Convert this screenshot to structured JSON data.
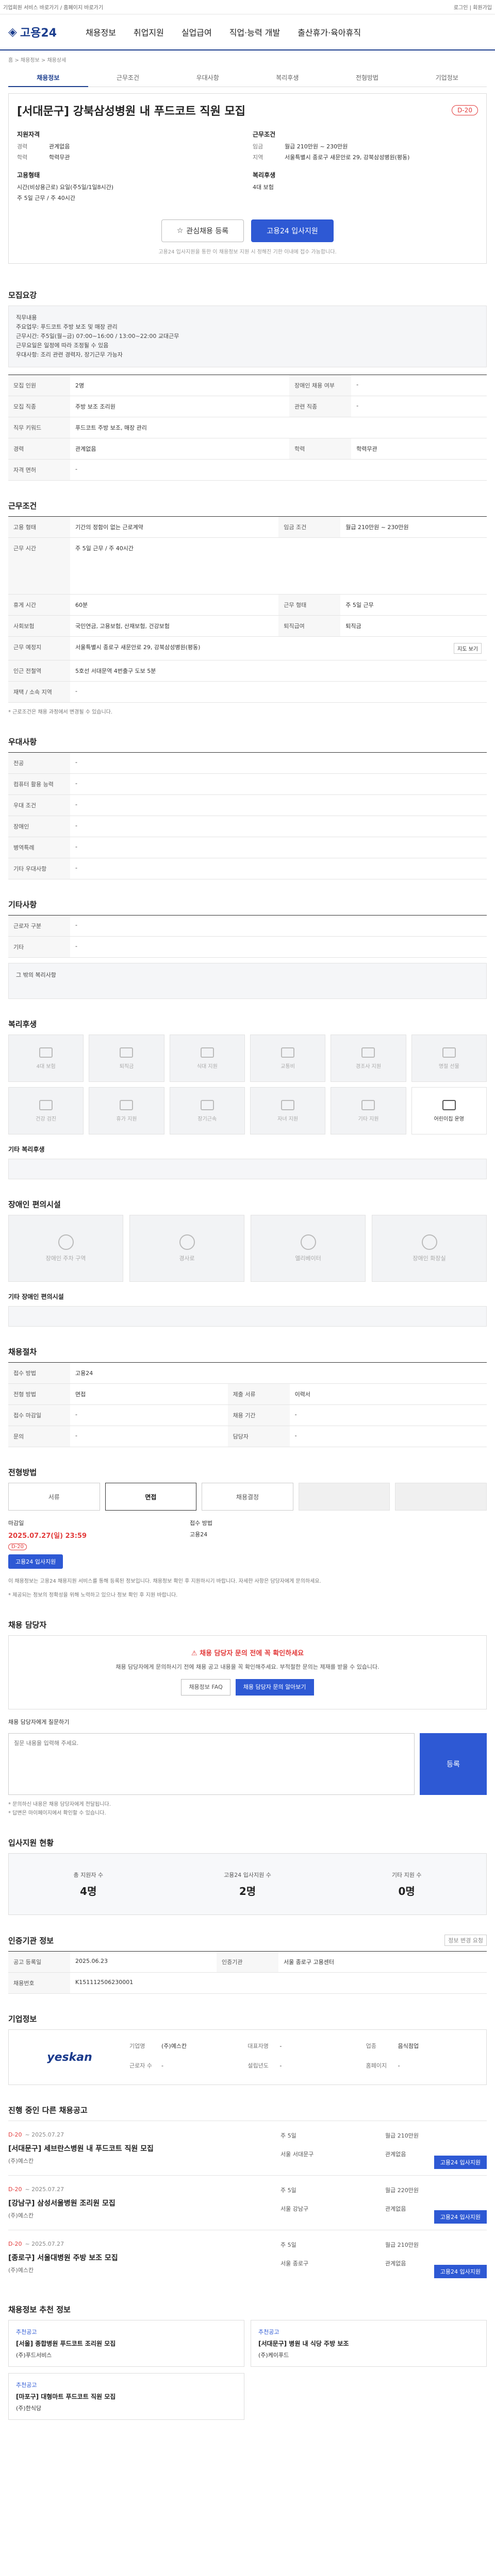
{
  "topbar": {
    "left": "기업회원 서비스 바로가기 / 홈페이지 바로가기",
    "right": "로그인 | 회원가입"
  },
  "logo": "고용24",
  "nav": [
    "채용정보",
    "취업지원",
    "실업급여",
    "직업·능력 개발",
    "출산휴가·육아휴직"
  ],
  "breadcrumb": "홈 > 채용정보 > 채용상세",
  "tabs": [
    "채용정보",
    "근무조건",
    "우대사항",
    "복리후생",
    "전형방법",
    "기업정보"
  ],
  "header": {
    "title": "[서대문구] 강북삼성병원 내 푸드코트 직원 모집",
    "badge": "D-20",
    "left_title": "지원자격",
    "left_rows": [
      {
        "k": "경력",
        "v": "관계없음"
      },
      {
        "k": "학력",
        "v": "학력무관"
      }
    ],
    "left_title2": "고용형태",
    "left_rows2": [
      {
        "k": "",
        "v": "시간(비상용근로) 요일(주5일/1일8시간)"
      },
      {
        "k": "",
        "v": "주 5일 근무 / 주 40시간"
      }
    ],
    "right_title": "근무조건",
    "right_rows": [
      {
        "k": "임금",
        "v": "월급 210만원 ~ 230만원"
      },
      {
        "k": "지역",
        "v": "서울특별시 종로구 새문안로 29, 강북삼성병원(평동)"
      },
      {
        "k": "",
        "v": ""
      }
    ],
    "right_title2": "복리후생",
    "right_rows2": [
      {
        "k": "",
        "v": "4대 보험"
      }
    ],
    "btn_scrap": "관심채용 등록",
    "btn_apply": "고용24 입사지원",
    "notice": "고용24 입사지원을 통한 이 채용정보 지원 시 정해진 기한 이내에 접수 가능합니다."
  },
  "recruit": {
    "title": "모집요강",
    "desc": "직무내용\n주요업무: 푸드코트 주방 보조 및 매장 관리\n근무시간: 주5일(월~금) 07:00~16:00 / 13:00~22:00 교대근무\n근무요일은 일정에 따라 조정될 수 있음\n우대사항: 조리 관련 경력자, 장기근무 가능자",
    "rows": [
      {
        "k": "모집 인원",
        "v": "2명",
        "k2": "장애인 채용 여부",
        "v2": "-"
      },
      {
        "k": "모집 직종",
        "v": "주방 보조 조리원",
        "k2": "관련 직종",
        "v2": "-"
      },
      {
        "k": "직무 키워드",
        "v": "푸드코트 주방 보조, 매장 관리",
        "k2": "",
        "v2": ""
      },
      {
        "k": "경력",
        "v": "관계없음",
        "k2": "학력",
        "v2": "학력무관"
      },
      {
        "k": "자격 면허",
        "v": "-",
        "k2": "",
        "v2": ""
      }
    ]
  },
  "condition": {
    "title": "근무조건",
    "rows": [
      {
        "k": "고용 형태",
        "v": "기간의 정함이 없는 근로계약",
        "k2": "임금 조건",
        "v2": "월급 210만원 ~ 230만원"
      },
      {
        "k": "근무 시간",
        "v": "주 5일 근무 / 주 40시간",
        "k2": "",
        "v2": ""
      },
      {
        "k": "휴게 시간",
        "v": "60분",
        "k2": "근무 형태",
        "v2": "주 5일 근무"
      },
      {
        "k": "사회보험",
        "v": "국민연금, 고용보험, 산재보험, 건강보험",
        "k2": "퇴직급여",
        "v2": "퇴직금"
      },
      {
        "k": "근무 예정지",
        "v": "서울특별시 종로구 새문안로 29, 강북삼성병원(평동)",
        "k2": "",
        "v2": ""
      },
      {
        "k": "인근 전철역",
        "v": "5호선 서대문역 4번출구 도보 5분",
        "k2": "",
        "v2": ""
      },
      {
        "k": "재택 / 소속 지역",
        "v": "-",
        "k2": "",
        "v2": ""
      }
    ],
    "map_btn": "지도 보기",
    "footnote": "* 근로조건은 채용 과정에서 변경될 수 있습니다."
  },
  "prefer": {
    "title": "우대사항",
    "rows": [
      {
        "k": "전공",
        "v": "-"
      },
      {
        "k": "컴퓨터 활용 능력",
        "v": "-"
      },
      {
        "k": "우대 조건",
        "v": "-"
      },
      {
        "k": "장애인",
        "v": "-"
      },
      {
        "k": "병역특례",
        "v": "-"
      },
      {
        "k": "기타 우대사항",
        "v": "-"
      }
    ]
  },
  "etc": {
    "title": "기타사항",
    "rows": [
      {
        "k": "근로자 구분",
        "v": "-"
      },
      {
        "k": "기타",
        "v": "-"
      }
    ],
    "extra": "그 밖의 복리사항"
  },
  "welfare": {
    "title": "복리후생",
    "items": [
      "4대 보험",
      "퇴직금",
      "식대 지원",
      "교통비",
      "경조사 지원",
      "명절 선물",
      "건강 검진",
      "휴가 지원",
      "장기근속",
      "자녀 지원",
      "기타 지원",
      "어린이집 운영"
    ],
    "extra_title": "기타 복리후생"
  },
  "disabled": {
    "title": "장애인 편의시설",
    "items": [
      "장애인 주차 구역",
      "경사로",
      "엘리베이터",
      "장애인 화장실"
    ],
    "extra_title": "기타 장애인 편의시설"
  },
  "hiring": {
    "title": "채용절차",
    "rows": [
      {
        "k": "접수 방법",
        "v": "고용24",
        "k2": "",
        "v2": ""
      },
      {
        "k": "전형 방법",
        "v": "면접",
        "k2": "제출 서류",
        "v2": "이력서"
      },
      {
        "k": "접수 마감일",
        "v": "-",
        "k2": "채용 기간",
        "v2": "-"
      },
      {
        "k": "문의",
        "v": "-",
        "k2": "담당자",
        "v2": "-"
      }
    ]
  },
  "process": {
    "title": "전형방법",
    "steps": [
      "서류",
      "면접",
      "채용결정",
      "",
      ""
    ],
    "deadline_label": "마감일",
    "deadline": "2025.07.27(일) 23:59",
    "dday": "D-20",
    "apply_btn": "고용24 입사지원",
    "method_label": "접수 방법",
    "method": "고용24"
  },
  "notice": {
    "text": "이 채용정보는 고용24 채용지원 서비스를 통해 등록된 정보입니다. 채용정보 확인 후 지원하시기 바랍니다. 자세한 사항은 담당자에게 문의하세요.",
    "footnote": "* 제공되는 정보의 정확성을 위해 노력하고 있으나 정보 확인 후 지원 바랍니다."
  },
  "inquiry": {
    "title": "채용 담당자",
    "warn_head": "채용 담당자 문의 전에 꼭 확인하세요",
    "warn_text": "채용 담당자에게 문의하시기 전에 채용 공고 내용을 꼭 확인해주세요. 부적절한 문의는 제재를 받을 수 있습니다.",
    "btn1": "채용정보 FAQ",
    "btn2": "채용 담당자 문의 알아보기",
    "form_title": "채용 담당자에게 질문하기",
    "placeholder": "질문 내용을 입력해 주세요.",
    "send": "등록",
    "notes": "* 문의하신 내용은 채용 담당자에게 전달됩니다.\n* 답변은 마이페이지에서 확인할 수 있습니다."
  },
  "stats": {
    "title": "입사지원 현황",
    "items": [
      {
        "label": "총 지원자 수",
        "num": "4명"
      },
      {
        "label": "고용24 입사지원 수",
        "num": "2명"
      },
      {
        "label": "기타 지원 수",
        "num": "0명"
      }
    ]
  },
  "regist": {
    "title": "인증기관 정보",
    "rows": [
      {
        "k": "공고 등록일",
        "v": "2025.06.23",
        "k2": "인증기관",
        "v2": "서울 종로구 고용센터"
      },
      {
        "k": "채용번호",
        "v": "K151112506230001",
        "k2": "",
        "v2": ""
      }
    ],
    "btn": "정보 변경 요청"
  },
  "company": {
    "title": "기업정보",
    "logo": "yeskan",
    "rows": [
      {
        "k": "기업명",
        "v": "(주)예스칸"
      },
      {
        "k": "대표자명",
        "v": "-"
      },
      {
        "k": "업종",
        "v": "음식점업"
      },
      {
        "k": "근로자 수",
        "v": "-"
      },
      {
        "k": "설립년도",
        "v": "-"
      },
      {
        "k": "홈페이지",
        "v": "-"
      }
    ]
  },
  "jobs": {
    "title": "진행 중인 다른 채용공고",
    "items": [
      {
        "date": "D-20",
        "range": "~ 2025.07.27",
        "title": "[서대문구] 세브란스병원 내 푸드코트 직원 모집",
        "company": "(주)예스칸",
        "info": [
          "주 5일",
          "월급 210만원",
          "서울 서대문구",
          "관계없음"
        ],
        "btn": "고용24 입사지원"
      },
      {
        "date": "D-20",
        "range": "~ 2025.07.27",
        "title": "[강남구] 삼성서울병원 조리원 모집",
        "company": "(주)예스칸",
        "info": [
          "주 5일",
          "월급 220만원",
          "서울 강남구",
          "관계없음"
        ],
        "btn": "고용24 입사지원"
      },
      {
        "date": "D-20",
        "range": "~ 2025.07.27",
        "title": "[종로구] 서울대병원 주방 보조 모집",
        "company": "(주)예스칸",
        "info": [
          "주 5일",
          "월급 210만원",
          "서울 종로구",
          "관계없음"
        ],
        "btn": "고용24 입사지원"
      }
    ]
  },
  "recommend": {
    "title": "채용정보 추천 정보",
    "cards": [
      {
        "tag": "추천공고",
        "title": "[서울] 종합병원 푸드코트 조리원 모집",
        "company": "(주)푸드서비스"
      },
      {
        "tag": "추천공고",
        "title": "[서대문구] 병원 내 식당 주방 보조",
        "company": "(주)케이푸드"
      },
      {
        "tag": "추천공고",
        "title": "[마포구] 대형마트 푸드코트 직원 모집",
        "company": "(주)한식당"
      }
    ]
  }
}
